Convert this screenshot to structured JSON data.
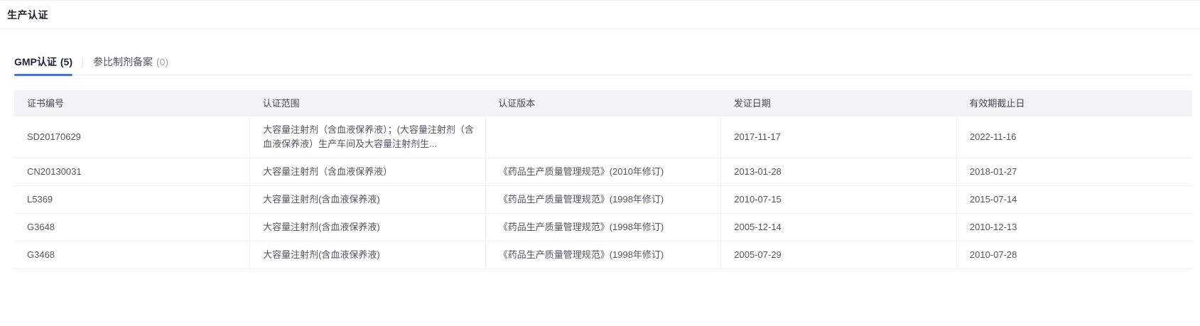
{
  "page": {
    "title": "生产认证"
  },
  "tabs": [
    {
      "label": "GMP认证",
      "count": "(5)",
      "active": true
    },
    {
      "label": "参比制剂备案",
      "count": "(0)",
      "active": false
    }
  ],
  "table": {
    "columns": [
      "证书编号",
      "认证范围",
      "认证版本",
      "发证日期",
      "有效期截止日"
    ],
    "column_keys": [
      "cert_no",
      "scope",
      "version",
      "issue_date",
      "expiry_date"
    ],
    "rows": [
      {
        "cert_no": "SD20170629",
        "scope": "大容量注射剂（含血液保养液）；(大容量注射剂（含血液保养液）生产车间及大容量注射剂生...",
        "version": "",
        "issue_date": "2017-11-17",
        "expiry_date": "2022-11-16"
      },
      {
        "cert_no": "CN20130031",
        "scope": "大容量注射剂（含血液保养液）",
        "version": "《药品生产质量管理规范》(2010年修订)",
        "issue_date": "2013-01-28",
        "expiry_date": "2018-01-27"
      },
      {
        "cert_no": "L5369",
        "scope": "大容量注射剂(含血液保养液)",
        "version": "《药品生产质量管理规范》(1998年修订)",
        "issue_date": "2010-07-15",
        "expiry_date": "2015-07-14"
      },
      {
        "cert_no": "G3648",
        "scope": "大容量注射剂(含血液保养液)",
        "version": "《药品生产质量管理规范》(1998年修订)",
        "issue_date": "2005-12-14",
        "expiry_date": "2010-12-13"
      },
      {
        "cert_no": "G3468",
        "scope": "大容量注射剂(含血液保养液)",
        "version": "《药品生产质量管理规范》(1998年修订)",
        "issue_date": "2005-07-29",
        "expiry_date": "2010-07-28"
      }
    ]
  },
  "colors": {
    "accent": "#4070f4",
    "table_header_bg": "#f2f3f7",
    "border": "#eef0f4",
    "title_text": "#1f2329",
    "body_text": "#51565d",
    "muted_text": "#9da2ac"
  }
}
